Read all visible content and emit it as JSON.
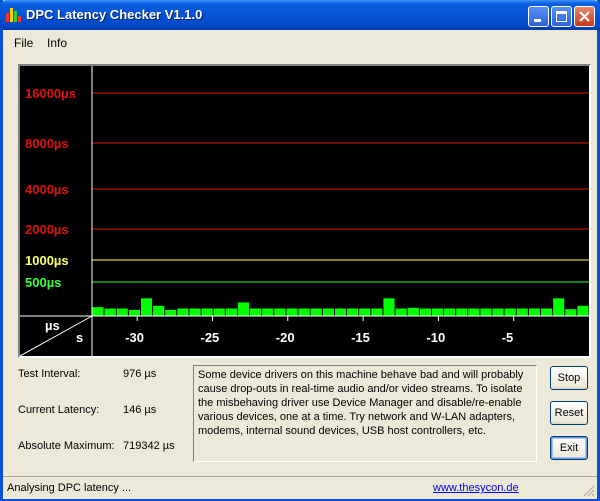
{
  "window": {
    "title": "DPC Latency Checker V1.1.0"
  },
  "menu": {
    "items": [
      "File",
      "Info"
    ]
  },
  "chart_data": {
    "type": "bar",
    "y_axis_label": "µs",
    "x_axis_label": "s",
    "y_levels": [
      {
        "label": "16000µs",
        "value": 16000,
        "color": "#e01010"
      },
      {
        "label": "8000µs",
        "value": 8000,
        "color": "#e01010"
      },
      {
        "label": "4000µs",
        "value": 4000,
        "color": "#e01010"
      },
      {
        "label": "2000µs",
        "value": 2000,
        "color": "#e01010"
      },
      {
        "label": "1000µs",
        "value": 1000,
        "color": "#ffff66"
      },
      {
        "label": "500µs",
        "value": 500,
        "color": "#33ff33"
      }
    ],
    "x_ticks": [
      "-30",
      "-25",
      "-20",
      "-15",
      "-10",
      "-5"
    ],
    "x_tick_values": [
      -30,
      -25,
      -20,
      -15,
      -10,
      -5
    ],
    "xlim": [
      -33,
      0
    ],
    "bar_color": "#00ff00",
    "values": [
      130,
      110,
      110,
      90,
      260,
      150,
      90,
      110,
      110,
      110,
      110,
      110,
      200,
      110,
      110,
      110,
      110,
      110,
      110,
      110,
      110,
      110,
      110,
      110,
      260,
      110,
      120,
      110,
      110,
      110,
      110,
      110,
      110,
      110,
      110,
      110,
      110,
      110,
      260,
      100,
      150
    ]
  },
  "stats": {
    "test_interval_label": "Test Interval:",
    "test_interval_value": "976 µs",
    "current_latency_label": "Current Latency:",
    "current_latency_value": "146 µs",
    "absolute_maximum_label": "Absolute Maximum:",
    "absolute_maximum_value": "719342 µs"
  },
  "message": "Some device drivers on this machine behave bad and will probably cause drop-outs in real-time audio and/or video streams. To isolate the misbehaving driver use Device Manager and disable/re-enable various devices, one at a time. Try network and W-LAN adapters, modems, internal sound devices, USB host controllers, etc.",
  "buttons": {
    "stop": "Stop",
    "reset": "Reset",
    "exit": "Exit"
  },
  "status": {
    "text": "Analysing DPC latency ...",
    "link": "www.thesycon.de"
  }
}
